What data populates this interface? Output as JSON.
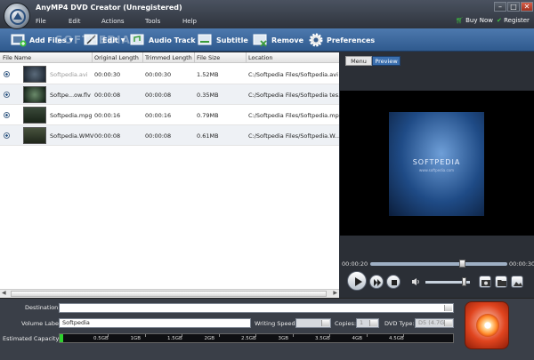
{
  "app": {
    "title": "AnyMP4 DVD Creator (Unregistered)"
  },
  "menu": [
    "File",
    "Edit",
    "Actions",
    "Tools",
    "Help"
  ],
  "header_links": {
    "buy_now": "Buy Now",
    "register": "Register"
  },
  "window_controls": {
    "minimize": "–",
    "maximize": "□",
    "close": "✕"
  },
  "toolbar": {
    "add_files": "Add Files",
    "edit": "Edit",
    "audio_track": "Audio Track",
    "subtitle": "Subtitle",
    "remove": "Remove",
    "preferences": "Preferences",
    "watermark": "SOFTPEDIA"
  },
  "file_list": {
    "columns": [
      "File Name",
      "Original Length",
      "Trimmed Length",
      "File Size",
      "Location"
    ],
    "rows": [
      {
        "name": "Softpedia.avi",
        "original": "00:00:30",
        "trimmed": "00:00:30",
        "size": "1.52MB",
        "location": "C:/Softpedia Files/Softpedia.avi",
        "dim": true
      },
      {
        "name": "Softpe...ow.flv",
        "original": "00:00:08",
        "trimmed": "00:00:08",
        "size": "0.35MB",
        "location": "C:/Softpedia Files/Softpedia tes..."
      },
      {
        "name": "Softpedia.mpg",
        "original": "00:00:16",
        "trimmed": "00:00:16",
        "size": "0.79MB",
        "location": "C:/Softpedia Files/Softpedia.mpg"
      },
      {
        "name": "Softpedia.WMV",
        "original": "00:00:08",
        "trimmed": "00:00:08",
        "size": "0.61MB",
        "location": "C:/Softpedia Files/Softpedia.W..."
      }
    ]
  },
  "preview": {
    "tabs": {
      "menu": "Menu",
      "preview": "Preview"
    },
    "frame_text": "SOFTPEDIA",
    "frame_sub": "www.softpedia.com",
    "time_current": "00:00:20",
    "time_total": "00:00:30",
    "seek_fraction": 0.67,
    "volume_fraction": 0.88
  },
  "bottom": {
    "destination_label": "Destination:",
    "destination_value": "",
    "volume_label": "Volume Label:",
    "volume_value": "Softpedia",
    "writing_speed_label": "Writing Speed:",
    "copies_label": "Copies:",
    "copies_value": "1",
    "dvd_type_label": "DVD Type:",
    "dvd_type_value": "D5 (4.7G)",
    "capacity_label": "Estimated Capacity:",
    "capacity_ticks": [
      "0.5GB",
      "1GB",
      "1.5GB",
      "2GB",
      "2.5GB",
      "3GB",
      "3.5GB",
      "4GB",
      "4.5GB"
    ],
    "capacity_used_fraction": 0.008
  },
  "colors": {
    "toolbar": "#3c69a0",
    "accent_green": "#2ed12e",
    "burn": "#e0441e"
  }
}
